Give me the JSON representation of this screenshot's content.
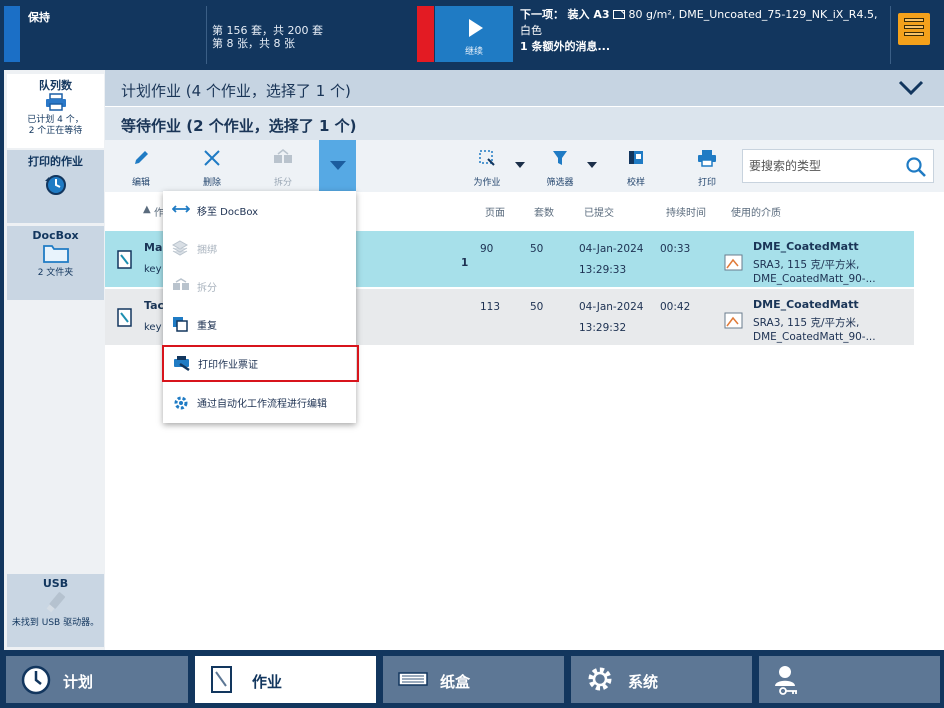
{
  "topbar": {
    "status": "保持",
    "counts_line1": "第 156 套，共 200 套",
    "counts_line2": "第 8 张，共 8 张",
    "continue_label": "继续",
    "next_label": "下一项：",
    "next_load": "装入 A3",
    "next_paper": "80 g/m², DME_Uncoated_75-129_NK_iX_R4.5,",
    "next_color": "白色",
    "next_message": "1 条额外的消息..."
  },
  "sidebar": {
    "queue_title": "队列数",
    "queue_sub1": "已计划 4 个，",
    "queue_sub2": "2 个正在等待",
    "printed_title": "打印的作业",
    "docbox_title": "DocBox",
    "docbox_sub": "2 文件夹",
    "usb_title": "USB",
    "usb_sub": "未找到 USB 驱动器。"
  },
  "main": {
    "planned_title": "计划作业 (4 个作业，选择了 1 个)",
    "waiting_title": "等待作业 (2 个作业，选择了 1 个)"
  },
  "toolbar": {
    "edit": "编辑",
    "delete": "删除",
    "split": "拆分",
    "as_job": "为作业",
    "filter": "筛选器",
    "proof": "校样",
    "print": "打印",
    "search_placeholder": "要搜索的类型"
  },
  "columns": {
    "name": "作",
    "pages": "页面",
    "sets": "套数",
    "submitted": "已提交",
    "duration": "持续时间",
    "media": "使用的介质"
  },
  "jobs": [
    {
      "name": "Mar",
      "sub": "key",
      "copies": "1",
      "pages": "90",
      "sets": "50",
      "date": "04-Jan-2024",
      "time": "13:29:33",
      "duration": "00:33",
      "media_name": "DME_CoatedMatt",
      "media_spec": "SRA3, 115 克/平方米,",
      "media_full": "DME_CoatedMatt_90-..."
    },
    {
      "name": "Tac",
      "sub": "key",
      "copies": "",
      "pages": "113",
      "sets": "50",
      "date": "04-Jan-2024",
      "time": "13:29:32",
      "duration": "00:42",
      "media_name": "DME_CoatedMatt",
      "media_spec": "SRA3, 115 克/平方米,",
      "media_full": "DME_CoatedMatt_90-..."
    }
  ],
  "menu": {
    "move_docbox": "移至 DocBox",
    "bind": "捆绑",
    "split": "拆分",
    "duplicate": "重复",
    "print_ticket": "打印作业票证",
    "edit_automation": "通过自动化工作流程进行编辑"
  },
  "nav": {
    "schedule": "计划",
    "jobs": "作业",
    "trays": "纸盒",
    "system": "系统"
  },
  "colors": {
    "navy": "#12365e",
    "selected_row": "#a7e0ea",
    "accent_blue": "#1f7bc4",
    "alert_red": "#e31b23",
    "highlight": "#d8141c"
  }
}
